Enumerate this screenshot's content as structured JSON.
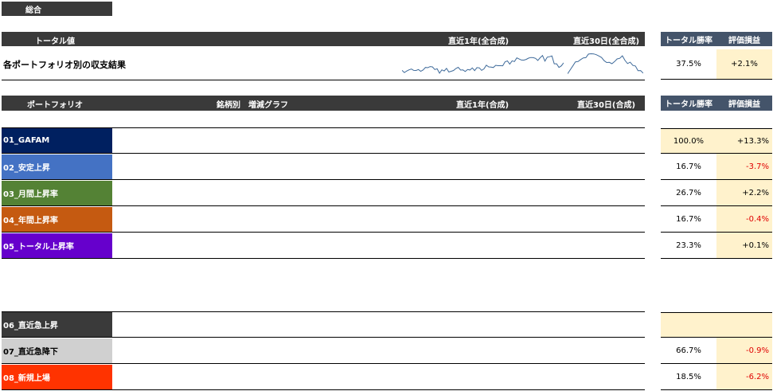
{
  "summary_tab": "総合",
  "total": {
    "header": "トータル値",
    "col_1y": "直近1年(全合成)",
    "col_30d": "直近30日(全合成)",
    "col_winrate": "トータル勝率",
    "col_pl": "評価損益",
    "row_label": "各ポートフォリオ別の収支結果",
    "winrate": "37.5%",
    "pl": "+2.1%"
  },
  "portfolio_header": {
    "portfolio": "ポートフォリオ",
    "bars": "銘柄別　増減グラフ",
    "col_1y": "直近1年(合成)",
    "col_30d": "直近30日(合成)",
    "col_winrate": "トータル勝率",
    "col_pl": "評価損益"
  },
  "colors": {
    "header_dark": "#3a3a3a",
    "header_blue": "#44546a",
    "highlight": "#fff2cc",
    "bar_pos": "#3e6a9a",
    "bar_neg": "#c00000",
    "line": "#3e6a9a",
    "negative_text": "#e00000"
  },
  "portfolios": [
    {
      "label": "01_GAFAM",
      "color": "#002060",
      "winrate": "100.0%",
      "pl": "+13.3%",
      "pl_sign": "pos",
      "winrate_hl": true,
      "pl_hl": true
    },
    {
      "label": "02_安定上昇",
      "color": "#4472c4",
      "winrate": "16.7%",
      "pl": "-3.7%",
      "pl_sign": "neg",
      "winrate_hl": false,
      "pl_hl": true
    },
    {
      "label": "03_月間上昇率",
      "color": "#548235",
      "winrate": "26.7%",
      "pl": "+2.2%",
      "pl_sign": "pos",
      "winrate_hl": false,
      "pl_hl": true
    },
    {
      "label": "04_年間上昇率",
      "color": "#c55a11",
      "winrate": "16.7%",
      "pl": "-0.4%",
      "pl_sign": "neg",
      "winrate_hl": false,
      "pl_hl": true
    },
    {
      "label": "05_トータル上昇率",
      "color": "#6600cc",
      "winrate": "23.3%",
      "pl": "+0.1%",
      "pl_sign": "pos",
      "winrate_hl": false,
      "pl_hl": true
    }
  ],
  "special": [
    {
      "label": "06_直近急上昇",
      "color": "#3a3a3a",
      "text_color": "#ffffff",
      "winrate": "",
      "pl": "",
      "pl_sign": "pos",
      "winrate_hl": true,
      "pl_hl": true
    },
    {
      "label": "07_直近急降下",
      "color": "#d0d0d0",
      "text_color": "#000000",
      "winrate": "66.7%",
      "pl": "-0.9%",
      "pl_sign": "neg",
      "winrate_hl": false,
      "pl_hl": true
    },
    {
      "label": "08_新規上場",
      "color": "#ff3300",
      "text_color": "#ffffff",
      "winrate": "18.5%",
      "pl": "-6.2%",
      "pl_sign": "neg",
      "winrate_hl": false,
      "pl_hl": true
    }
  ]
}
